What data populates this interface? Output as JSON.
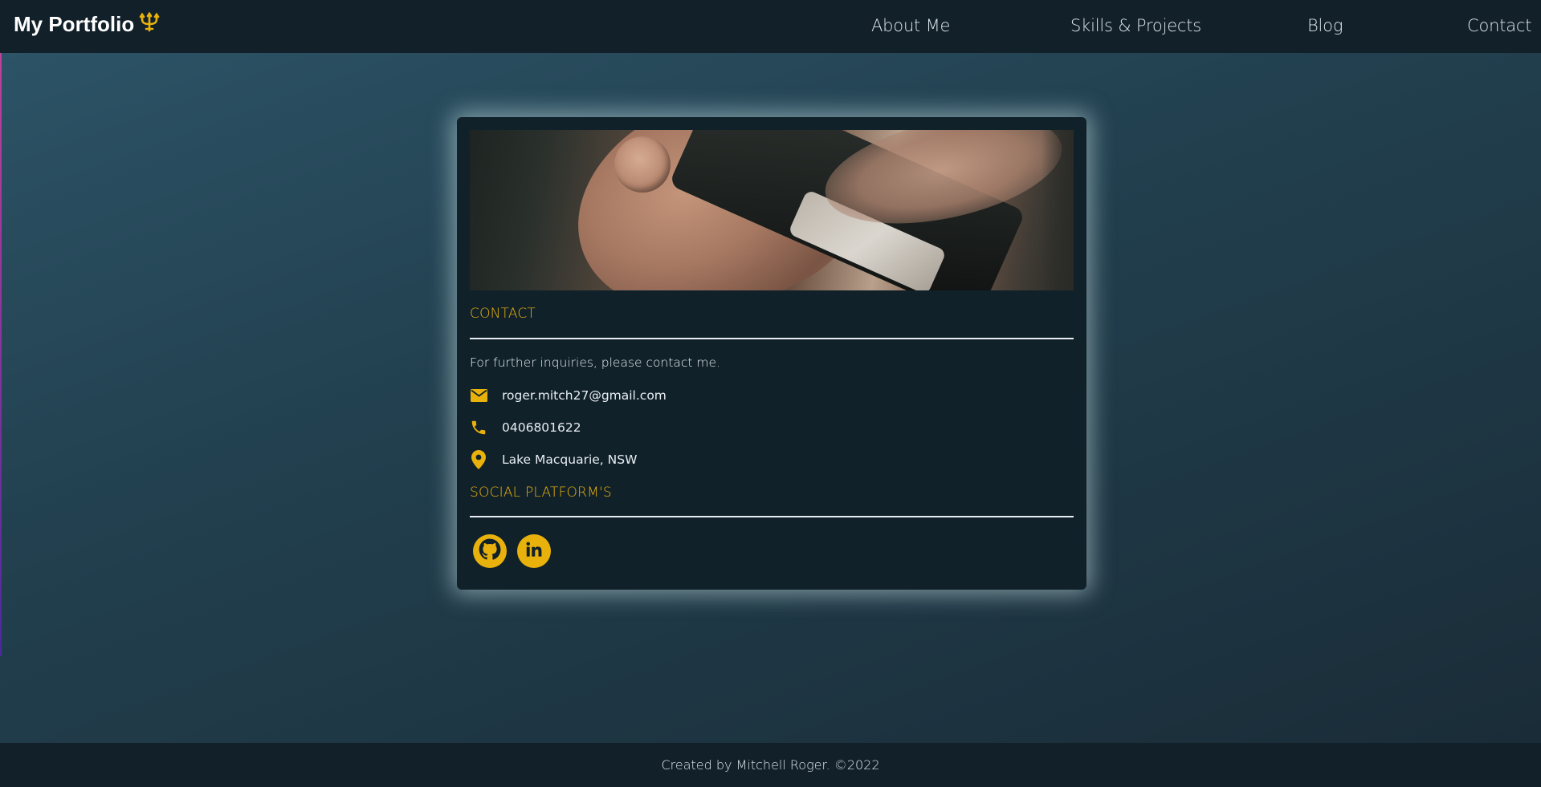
{
  "brand": {
    "title": "My Portfolio",
    "emblem": "trident-icon"
  },
  "nav": {
    "items": [
      {
        "label": "About Me"
      },
      {
        "label": "Skills & Projects"
      },
      {
        "label": "Blog"
      },
      {
        "label": "Contact"
      }
    ]
  },
  "contact_card": {
    "heading": "CONTACT",
    "intro": "For further inquiries, please contact me.",
    "email": "roger.mitch27@gmail.com",
    "phone": "0406801622",
    "location": "Lake Macquarie, NSW",
    "social_heading": "SOCIAL PLATFORM'S",
    "socials": [
      {
        "icon": "github-icon"
      },
      {
        "icon": "linkedin-icon"
      }
    ]
  },
  "footer": {
    "text": "Created by Mitchell Roger. ©2022"
  },
  "colors": {
    "accent": "#e9b10c",
    "navbar": "#12202a",
    "card": "#11212a",
    "text": "#e8eef2"
  }
}
